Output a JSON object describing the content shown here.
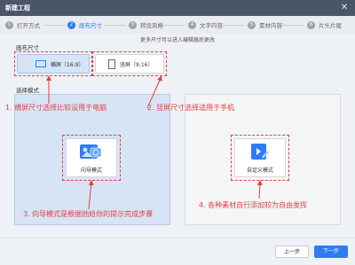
{
  "window": {
    "title": "新建工程",
    "close_glyph": "✕"
  },
  "steps": [
    {
      "num": "1",
      "label": "打开方式"
    },
    {
      "num": "2",
      "label": "画布尺寸"
    },
    {
      "num": "3",
      "label": "转设风格"
    },
    {
      "num": "4",
      "label": "文字内容"
    },
    {
      "num": "5",
      "label": "素材内容"
    },
    {
      "num": "6",
      "label": "片头片尾"
    }
  ],
  "active_step": "2",
  "subtitle": "更多尺寸可以进入编辑器后更改",
  "canvas_size": {
    "label": "画布尺寸",
    "landscape": "横屏（16:9）",
    "portrait": "竖屏（9:16）"
  },
  "mode": {
    "label": "选择模式",
    "wizard": "向导模式",
    "custom": "自定义模式"
  },
  "annotations": {
    "a1": "1. 横屏尺寸选择比较设用于电脑",
    "a2": "2. 竖屏尺寸选择适用于手机",
    "a3": "3. 向导模式是根据他给你的提示完成步骤",
    "a4": "4. 各种素材自行添加较为自由发挥"
  },
  "footer": {
    "prev": "上一步",
    "next": "下一步"
  },
  "colors": {
    "accent": "#2f7cf6",
    "annotation": "#e53e3e",
    "titlebar": "#4a5568"
  }
}
